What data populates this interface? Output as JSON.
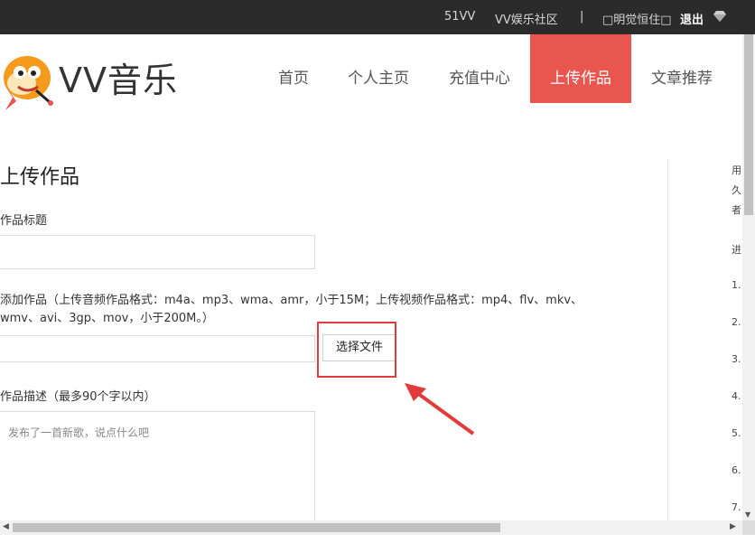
{
  "topbar": {
    "links": [
      "51VV",
      "VV娱乐社区",
      "|",
      "□明觉恒住□",
      "退出"
    ],
    "colors": {
      "bg": "#2b2b2b",
      "text": "#d8d8d8"
    }
  },
  "header": {
    "brand": "VV音乐",
    "nav": [
      "首页",
      "个人主页",
      "充值中心",
      "上传作品",
      "文章推荐"
    ],
    "active_nav": "上传作品",
    "colors": {
      "active_bg": "#e8564f"
    }
  },
  "form": {
    "title": "上传作品",
    "title_label": "作品标题",
    "file_label": "添加作品（上传音频作品格式：m4a、mp3、wma、amr，小于15M；上传视频作品格式：mp4、flv、mkv、wmv、avi、3gp、mov，小于200M。）",
    "file_button": "选择文件",
    "desc_label": "作品描述（最多90个字以内）",
    "desc_placeholder": "发布了一首新歌，说点什么吧"
  },
  "sidebar": {
    "fragments": [
      "用",
      "久",
      "者",
      "进",
      "1.",
      "2.",
      "3.",
      "4.",
      "5.",
      "6.",
      "7."
    ]
  },
  "annotation": {
    "highlight_color": "#e23b3b"
  }
}
